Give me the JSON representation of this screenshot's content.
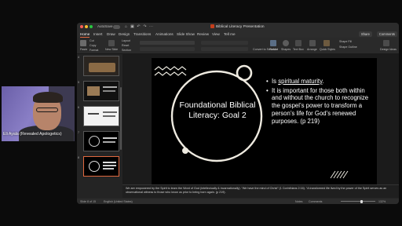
{
  "webcam": {
    "name": "Eli Ayala (Revealed Apologetics)"
  },
  "window": {
    "autosave_label": "AutoSave",
    "doc_title": "Biblical Literacy Presentation"
  },
  "tabs": [
    "Home",
    "Insert",
    "Draw",
    "Design",
    "Transitions",
    "Animations",
    "Slide Show",
    "Review",
    "View",
    "Tell me"
  ],
  "top_buttons": {
    "share": "Share",
    "comments": "Comments"
  },
  "ribbon": {
    "paste": "Paste",
    "cut": "Cut",
    "copy": "Copy",
    "format": "Format",
    "new_slide": "New Slide",
    "layout": "Layout",
    "reset": "Reset",
    "section": "Section",
    "convert": "Convert to SmartArt",
    "picture": "Picture",
    "shapes": "Shapes",
    "textbox": "Text Box",
    "arrange": "Arrange",
    "quick_styles": "Quick Styles",
    "shape_fill": "Shape Fill",
    "shape_outline": "Shape Outline",
    "design_ideas": "Design Ideas"
  },
  "slide": {
    "title": "Foundational Biblical Literacy: Goal 2",
    "bullets": [
      {
        "pre": "Is ",
        "underlined": "spiritual maturity",
        "post": "."
      },
      {
        "pre": "It is important for those both within and without the church to recognize the gospel’s power to transform a person’s life for God’s renewed purposes. (p 219)",
        "underlined": "",
        "post": ""
      }
    ]
  },
  "notes": "We are empowered by the Spirit to learn the Word of God (intellectually & incarnationally). “We have the mind of Christ” (1 Corinthians 2:16). “A transformed life lived by the power of the Spirit serves as an observational witness to those who know us prior to being born again. (p 219).",
  "status": {
    "slide_of": "Slide 8 of 15",
    "language": "English (United States)",
    "notes_btn": "Notes",
    "comments_btn": "Comments",
    "zoom": "132%",
    "zoom_value": 0.6
  },
  "thumbnails": [
    {
      "num": "4"
    },
    {
      "num": "5"
    },
    {
      "num": "6"
    },
    {
      "num": "7"
    },
    {
      "num": "8"
    }
  ]
}
